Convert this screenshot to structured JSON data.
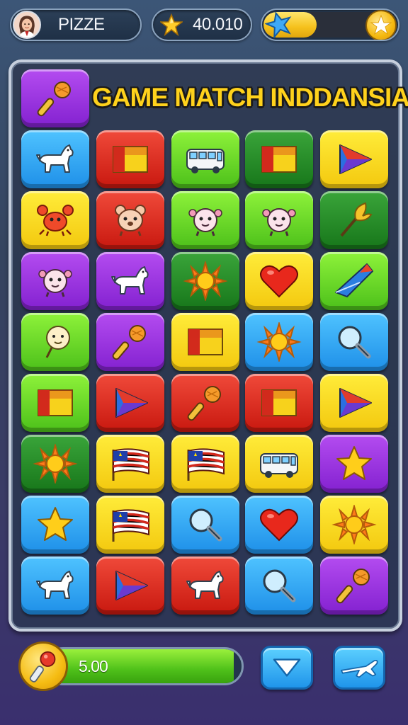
{
  "top_bar": {
    "player_name": "PIZZE",
    "score": "40.010",
    "level_progress": 0.42
  },
  "board": {
    "title": "GAME MATCH INDDANSIA",
    "first_tile": {
      "icon": "microphone-icon",
      "color": "purple"
    },
    "rows": [
      [
        {
          "icon": "dog-icon",
          "color": "blue"
        },
        {
          "icon": "flag-icon",
          "color": "red"
        },
        {
          "icon": "bus-icon",
          "color": "lime"
        },
        {
          "icon": "flag-icon",
          "color": "dgreen"
        },
        {
          "icon": "play-icon",
          "color": "yellow"
        }
      ],
      [
        {
          "icon": "crab-icon",
          "color": "yellow"
        },
        {
          "icon": "bear-icon",
          "color": "red"
        },
        {
          "icon": "creature-icon",
          "color": "lime"
        },
        {
          "icon": "creature-icon",
          "color": "lime"
        },
        {
          "icon": "torch-icon",
          "color": "dgreen"
        }
      ],
      [
        {
          "icon": "creature-icon",
          "color": "purple"
        },
        {
          "icon": "dog-icon",
          "color": "purple"
        },
        {
          "icon": "sun-icon",
          "color": "dgreen"
        },
        {
          "icon": "heart-icon",
          "color": "yellow"
        },
        {
          "icon": "kite-icon",
          "color": "lime"
        }
      ],
      [
        {
          "icon": "lollipop-icon",
          "color": "lime"
        },
        {
          "icon": "microphone-icon",
          "color": "purple"
        },
        {
          "icon": "flag-icon",
          "color": "yellow"
        },
        {
          "icon": "sun-icon",
          "color": "blue"
        },
        {
          "icon": "magnifier-icon",
          "color": "blue"
        }
      ],
      [
        {
          "icon": "flag-icon",
          "color": "lime"
        },
        {
          "icon": "play-icon",
          "color": "red"
        },
        {
          "icon": "microphone-icon",
          "color": "red"
        },
        {
          "icon": "flag-icon",
          "color": "red"
        },
        {
          "icon": "play-icon",
          "color": "yellow"
        }
      ],
      [
        {
          "icon": "sun-icon",
          "color": "dgreen"
        },
        {
          "icon": "striped-flag-icon",
          "color": "yellow"
        },
        {
          "icon": "striped-flag-icon",
          "color": "yellow"
        },
        {
          "icon": "bus-icon",
          "color": "yellow"
        },
        {
          "icon": "star-icon",
          "color": "purple"
        }
      ],
      [
        {
          "icon": "star-icon",
          "color": "blue"
        },
        {
          "icon": "striped-flag-icon",
          "color": "yellow"
        },
        {
          "icon": "magnifier-icon",
          "color": "blue"
        },
        {
          "icon": "heart-icon",
          "color": "blue"
        },
        {
          "icon": "sun-icon",
          "color": "yellow"
        }
      ],
      [
        {
          "icon": "dog-icon",
          "color": "blue"
        },
        {
          "icon": "play-icon",
          "color": "red"
        },
        {
          "icon": "dog-icon",
          "color": "red"
        },
        {
          "icon": "magnifier-icon",
          "color": "blue"
        },
        {
          "icon": "microphone-icon",
          "color": "purple"
        }
      ]
    ]
  },
  "bottom_bar": {
    "progress_value": "5.00",
    "progress_fill": 0.96
  },
  "colors": {
    "blue": "#2aa3f5",
    "red": "#e02a1e",
    "lime": "#6fdc2a",
    "dgreen": "#23892a",
    "yellow": "#fbd822",
    "purple": "#9a35e0"
  }
}
